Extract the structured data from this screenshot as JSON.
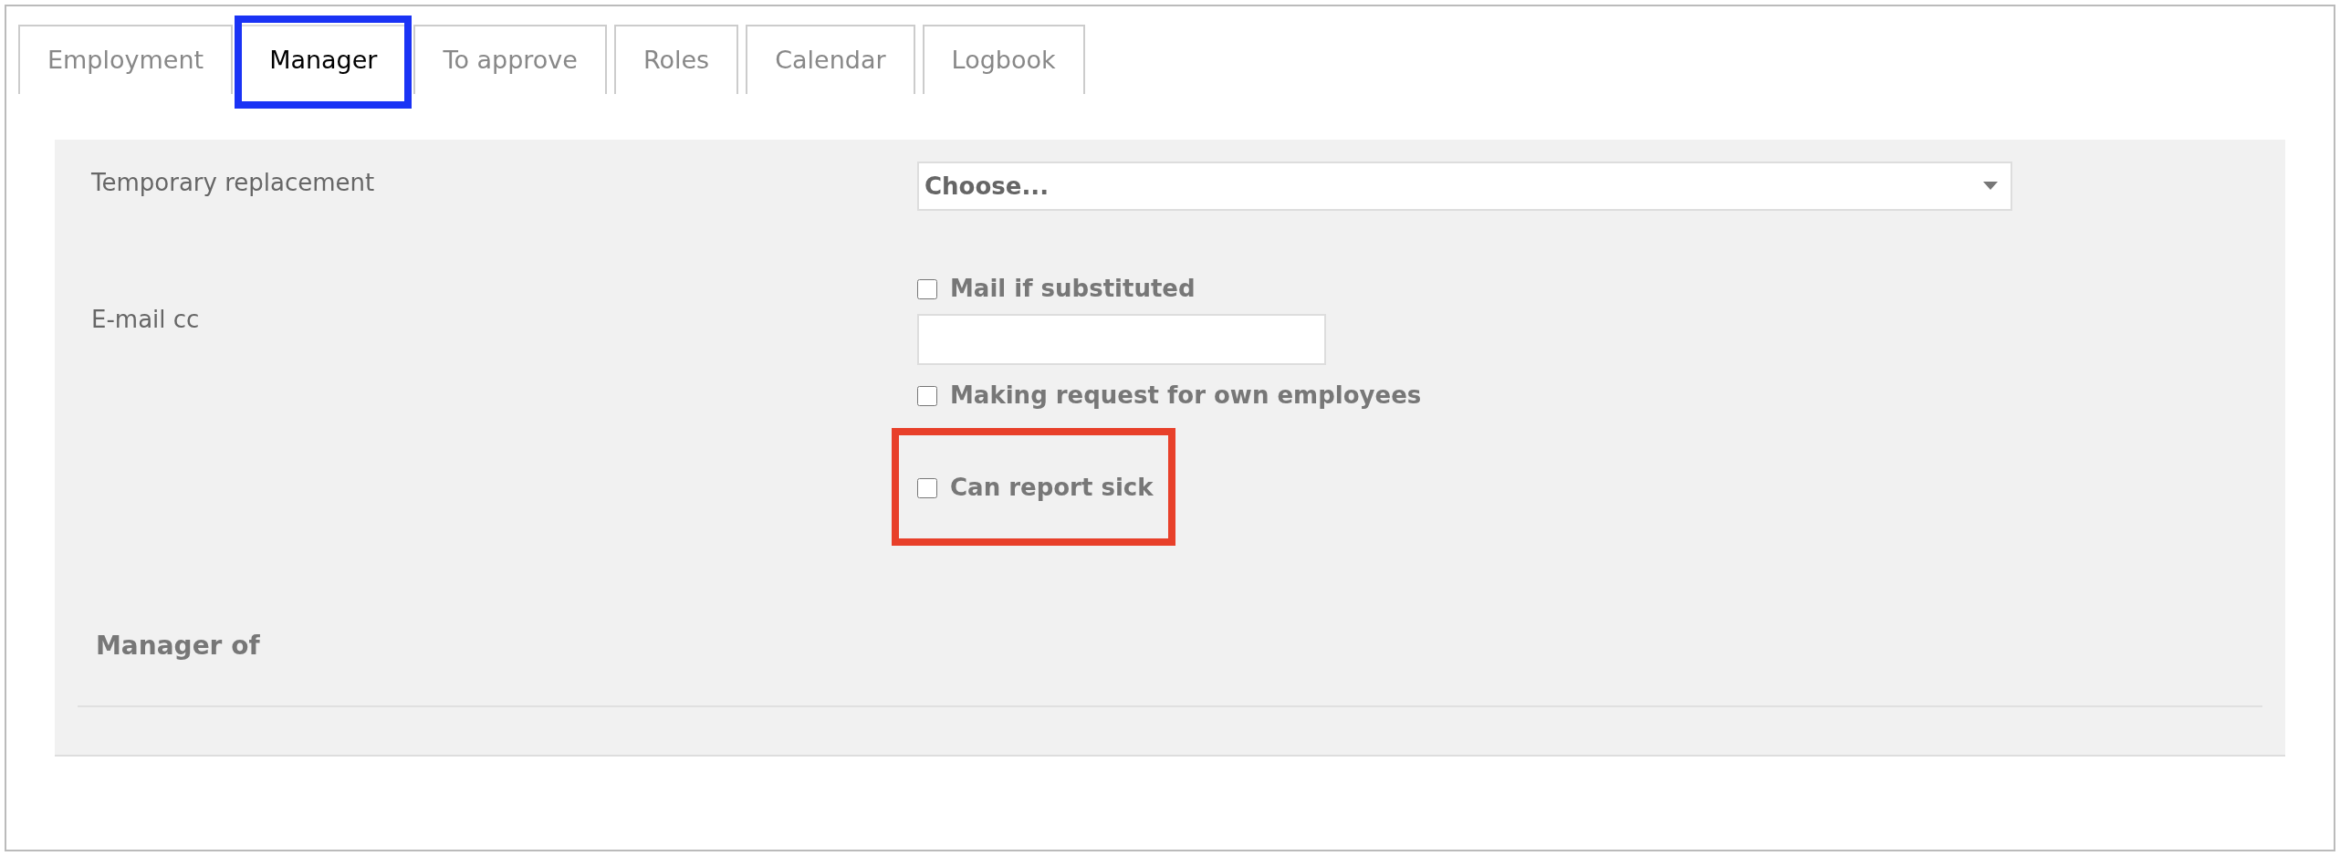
{
  "tabs": [
    {
      "label": "Employment",
      "selected": false
    },
    {
      "label": "Manager",
      "selected": true,
      "color": "#1a33f5"
    },
    {
      "label": "To approve",
      "selected": false
    },
    {
      "label": "Roles",
      "selected": false
    },
    {
      "label": "Calendar",
      "selected": false
    },
    {
      "label": "Logbook",
      "selected": false
    }
  ],
  "temporary_replacement": {
    "label": "Temporary replacement",
    "value": "Choose..."
  },
  "mail_if_substituted": {
    "label": "Mail if substituted",
    "checked": false
  },
  "email_cc": {
    "label": "E-mail cc"
  },
  "options": [
    {
      "label": "Making request for own employees",
      "checked": false
    },
    {
      "label": "Can report sick",
      "checked": false,
      "color": "#e8402a"
    }
  ],
  "section_title": "Manager of"
}
